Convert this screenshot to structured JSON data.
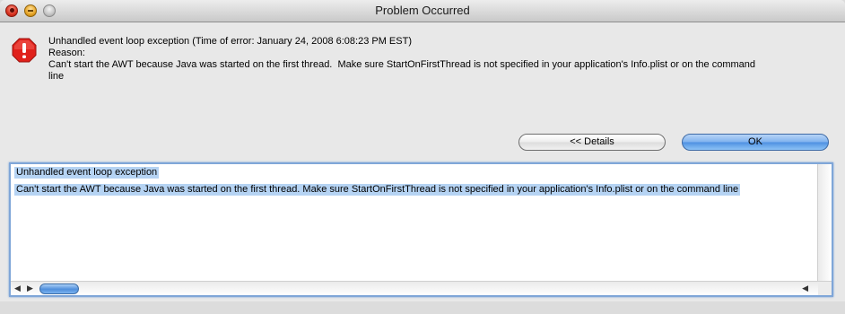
{
  "window": {
    "title": "Problem Occurred"
  },
  "message": {
    "line1": "Unhandled event loop exception (Time of error: January 24, 2008 6:08:23 PM EST)",
    "line2": "Reason:",
    "line3": "Can't start the AWT because Java was started on the first thread.  Make sure StartOnFirstThread is not specified in your application's Info.plist or on the command",
    "line4": "line"
  },
  "buttons": {
    "details_label": "<< Details",
    "ok_label": "OK"
  },
  "details_panel": {
    "lines": [
      "Unhandled event loop exception",
      "Can't start the AWT because Java was started on the first thread.  Make sure StartOnFirstThread is not specified in your application's Info.plist or on the command line"
    ]
  },
  "icons": {
    "error": "error-stop-icon",
    "close": "close-icon",
    "minimize": "minimize-icon",
    "zoom": "zoom-icon"
  },
  "colors": {
    "selection": "#b5d3f3",
    "ok_button": "#5c9be6",
    "error_icon": "#e0211b"
  }
}
